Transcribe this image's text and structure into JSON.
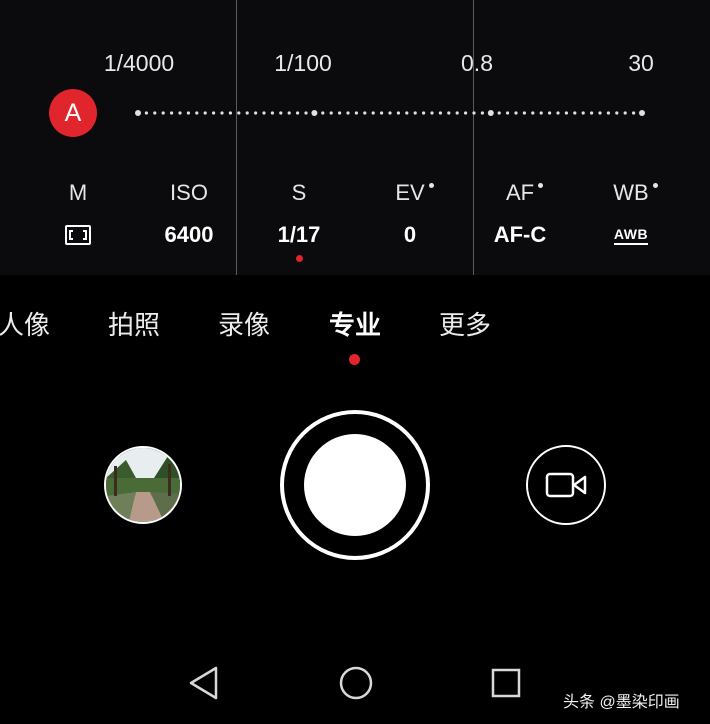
{
  "dial": {
    "scale_labels": [
      "1/4000",
      "1/100",
      "0.8",
      "30"
    ],
    "auto_badge": "A",
    "accent_color": "#e0262c"
  },
  "params": [
    {
      "name": "M",
      "value": "",
      "icon": "metering-icon"
    },
    {
      "name": "ISO",
      "value": "6400"
    },
    {
      "name": "S",
      "value": "1/17",
      "selected": true
    },
    {
      "name": "EV",
      "value": "0"
    },
    {
      "name": "AF",
      "value": "AF-C"
    },
    {
      "name": "WB",
      "value": "AWB"
    }
  ],
  "modes": [
    "人像",
    "拍照",
    "录像",
    "专业",
    "更多"
  ],
  "active_mode": "专业",
  "controls": {
    "gallery": "gallery-thumbnail",
    "shutter": "shutter-button",
    "video": "video-camera-icon"
  },
  "nav": [
    "back-icon",
    "home-icon",
    "recents-icon"
  ],
  "watermark": "头条 @墨染印画"
}
